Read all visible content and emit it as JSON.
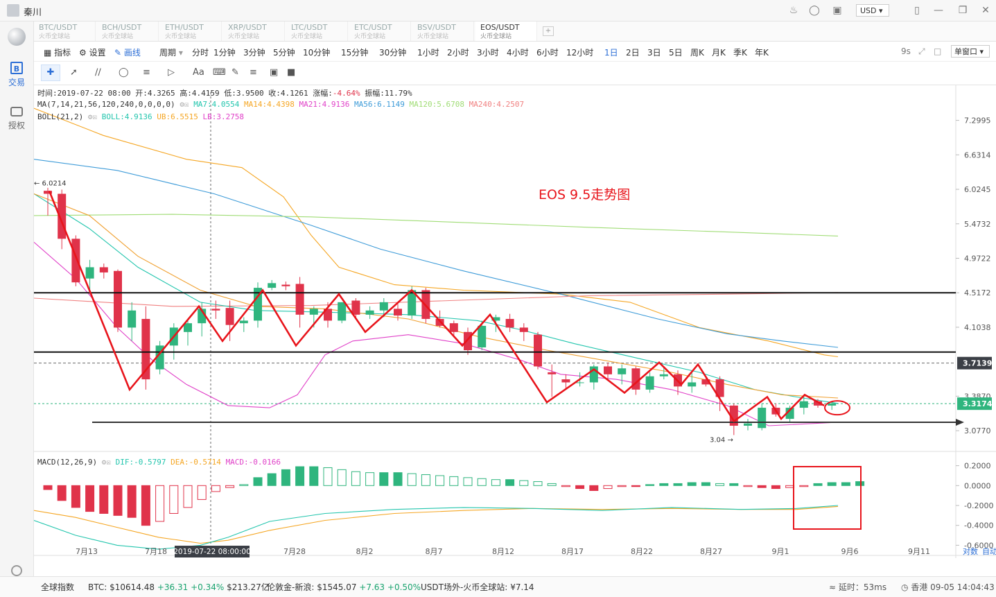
{
  "titlebar": {
    "username": "秦川",
    "currency": "USD"
  },
  "sidebar": {
    "trade_label": "交易",
    "auth_label": "授权"
  },
  "tabs": [
    {
      "name": "BTC/USDT",
      "sub": "火币全球站"
    },
    {
      "name": "BCH/USDT",
      "sub": "火币全球站"
    },
    {
      "name": "ETH/USDT",
      "sub": "火币全球站"
    },
    {
      "name": "XRP/USDT",
      "sub": "火币全球站"
    },
    {
      "name": "LTC/USDT",
      "sub": "火币全球站"
    },
    {
      "name": "ETC/USDT",
      "sub": "火币全球站"
    },
    {
      "name": "BSV/USDT",
      "sub": "火币全球站"
    },
    {
      "name": "EOS/USDT",
      "sub": "火币全球站"
    }
  ],
  "toolbar": {
    "indicator": "指标",
    "settings": "设置",
    "draw": "画线",
    "period": "周期",
    "periods": [
      "分时",
      "1分钟",
      "3分钟",
      "5分钟",
      "10分钟",
      "15分钟",
      "30分钟",
      "1小时",
      "2小时",
      "3小时",
      "4小时",
      "6小时",
      "12小时",
      "1日",
      "2日",
      "3日",
      "5日",
      "周K",
      "月K",
      "季K",
      "年K"
    ],
    "active_period": "1日",
    "refresh": "9s",
    "window": "单窗口",
    "text_tool": "Aa"
  },
  "info": {
    "ohlc": {
      "time_label": "时间:",
      "time": "2019-07-22 08:00",
      "open_label": "开:",
      "open": "4.3265",
      "high_label": "高:",
      "high": "4.4159",
      "low_label": "低:",
      "low": "3.9500",
      "close_label": "收:",
      "close": "4.1261",
      "chg_label": "涨幅:",
      "chg": "-4.64%",
      "amp_label": "振幅:",
      "amp": "11.79%"
    },
    "ma": {
      "label": "MA(7,14,21,56,120,240,0,0,0,0)",
      "ma7": "MA7:4.0554",
      "ma14": "MA14:4.4398",
      "ma21": "MA21:4.9136",
      "ma56": "MA56:6.1149",
      "ma120": "MA120:5.6708",
      "ma240": "MA240:4.2507"
    },
    "boll": {
      "label": "BOLL(21,2)",
      "boll": "BOLL:4.9136",
      "ub": "UB:6.5515",
      "lb": "LB:3.2758"
    },
    "macd": {
      "label": "MACD(12,26,9)",
      "dif": "DIF:-0.5797",
      "dea": "DEA:-0.5714",
      "macd": "MACD:-0.0166"
    }
  },
  "colors": {
    "up": "#2fb57e",
    "down": "#e0334a",
    "ma7": "#22c5ad",
    "ma14": "#f5a623",
    "ma21": "#e040c8",
    "ma56": "#3d9bd8",
    "ma120": "#9fdc74",
    "ma240": "#f08080",
    "annot": "#e8141b"
  },
  "chart_data": {
    "type": "candlestick",
    "title": "EOS  9.5走势图",
    "price_axis": [
      "7.2995",
      "6.6314",
      "6.0245",
      "5.4732",
      "4.9722",
      "4.5172",
      "4.1038",
      "3.7139",
      "3.3870",
      "3.3174",
      "3.0770"
    ],
    "price_tags": {
      "current": "3.3174",
      "line": "3.7139",
      "high_mark": "6.0214",
      "low_mark": "3.04"
    },
    "macd_axis": [
      "0.2000",
      "0.0000",
      "-0.2000",
      "-0.4000",
      "-0.6000"
    ],
    "x_labels": [
      "7月13",
      "7月18",
      "7月28",
      "8月2",
      "8月7",
      "8月12",
      "8月17",
      "8月22",
      "8月27",
      "9月1",
      "9月6",
      "9月11"
    ],
    "crosshair_label": "2019-07-22 08:00:00",
    "corner_labels": [
      "对数",
      "自动"
    ],
    "candles": [
      [
        6.0,
        6.05,
        5.6,
        5.95
      ],
      [
        5.95,
        6.02,
        5.1,
        5.25
      ],
      [
        5.25,
        5.3,
        4.6,
        4.65
      ],
      [
        4.7,
        4.95,
        4.5,
        4.85
      ],
      [
        4.85,
        4.9,
        4.7,
        4.78
      ],
      [
        4.8,
        4.82,
        4.05,
        4.1
      ],
      [
        4.1,
        4.4,
        3.95,
        4.3
      ],
      [
        4.2,
        4.35,
        3.45,
        3.55
      ],
      [
        3.65,
        3.95,
        3.6,
        3.9
      ],
      [
        3.9,
        4.15,
        3.75,
        4.1
      ],
      [
        4.05,
        4.2,
        3.9,
        4.15
      ],
      [
        4.15,
        4.4,
        4.0,
        4.32
      ],
      [
        4.32,
        4.42,
        4.2,
        4.3
      ],
      [
        4.33,
        4.42,
        3.95,
        4.13
      ],
      [
        4.15,
        4.22,
        4.05,
        4.18
      ],
      [
        4.18,
        4.65,
        4.1,
        4.58
      ],
      [
        4.58,
        4.68,
        4.55,
        4.64
      ],
      [
        4.62,
        4.66,
        4.55,
        4.6
      ],
      [
        4.63,
        4.72,
        4.1,
        4.25
      ],
      [
        4.25,
        4.35,
        4.1,
        4.32
      ],
      [
        4.32,
        4.4,
        4.1,
        4.18
      ],
      [
        4.18,
        4.4,
        4.15,
        4.4
      ],
      [
        4.42,
        4.45,
        4.2,
        4.25
      ],
      [
        4.25,
        4.35,
        4.2,
        4.3
      ],
      [
        4.3,
        4.45,
        4.22,
        4.4
      ],
      [
        4.32,
        4.38,
        4.18,
        4.24
      ],
      [
        4.24,
        4.6,
        4.2,
        4.55
      ],
      [
        4.55,
        4.58,
        4.15,
        4.2
      ],
      [
        4.2,
        4.3,
        4.1,
        4.12
      ],
      [
        4.15,
        4.18,
        4.0,
        4.05
      ],
      [
        4.05,
        4.1,
        3.8,
        3.85
      ],
      [
        3.88,
        4.18,
        3.85,
        4.12
      ],
      [
        4.18,
        4.25,
        4.05,
        4.22
      ],
      [
        4.2,
        4.26,
        4.05,
        4.1
      ],
      [
        4.1,
        4.15,
        3.95,
        4.05
      ],
      [
        4.02,
        4.05,
        3.65,
        3.68
      ],
      [
        3.62,
        3.7,
        3.38,
        3.6
      ],
      [
        3.55,
        3.6,
        3.45,
        3.52
      ],
      [
        3.52,
        3.62,
        3.48,
        3.52
      ],
      [
        3.52,
        3.7,
        3.45,
        3.68
      ],
      [
        3.68,
        3.72,
        3.55,
        3.6
      ],
      [
        3.6,
        3.7,
        3.5,
        3.66
      ],
      [
        3.66,
        3.68,
        3.4,
        3.45
      ],
      [
        3.45,
        3.62,
        3.42,
        3.58
      ],
      [
        3.58,
        3.68,
        3.55,
        3.6
      ],
      [
        3.6,
        3.64,
        3.4,
        3.48
      ],
      [
        3.48,
        3.62,
        3.42,
        3.52
      ],
      [
        3.55,
        3.58,
        3.48,
        3.5
      ],
      [
        3.55,
        3.58,
        3.25,
        3.38
      ],
      [
        3.3,
        3.32,
        3.04,
        3.12
      ],
      [
        3.12,
        3.18,
        3.08,
        3.14
      ],
      [
        3.1,
        3.32,
        3.08,
        3.28
      ],
      [
        3.28,
        3.32,
        3.2,
        3.22
      ],
      [
        3.18,
        3.3,
        3.15,
        3.28
      ],
      [
        3.28,
        3.38,
        3.22,
        3.34
      ],
      [
        3.34,
        3.36,
        3.28,
        3.3
      ],
      [
        3.3,
        3.34,
        3.26,
        3.32
      ]
    ],
    "macd_hist": [
      -0.04,
      -0.15,
      -0.22,
      -0.26,
      -0.28,
      -0.3,
      -0.32,
      -0.4,
      -0.36,
      -0.28,
      -0.22,
      -0.14,
      -0.06,
      -0.02,
      0.01,
      0.08,
      0.12,
      0.16,
      0.19,
      0.19,
      0.18,
      0.16,
      0.14,
      0.13,
      0.13,
      0.13,
      0.12,
      0.11,
      0.1,
      0.09,
      0.08,
      0.07,
      0.06,
      0.06,
      0.05,
      0.04,
      0.02,
      -0.01,
      -0.03,
      -0.05,
      -0.03,
      -0.01,
      -0.01,
      0.01,
      0.02,
      0.02,
      0.03,
      0.03,
      0.02,
      0.02,
      -0.01,
      -0.02,
      -0.03,
      -0.02,
      -0.01,
      0.02,
      0.03,
      0.03,
      0.04
    ]
  },
  "bottombar": {
    "index_label": "全球指数",
    "btc_label": "BTC:",
    "btc_price": "$10614.48",
    "btc_chg": "+36.31",
    "btc_pct": "+0.34%",
    "btc_cap": "$213.27亿",
    "gold_label": "伦敦金-新浪:",
    "gold_price": "$1545.07",
    "gold_chg": "+7.63",
    "gold_pct": "+0.50%",
    "usdt_label": "USDT场外-火币全球站:",
    "usdt_price": "¥7.14",
    "latency": "延时：53ms",
    "location": "香港 09-05 14:04:43"
  }
}
